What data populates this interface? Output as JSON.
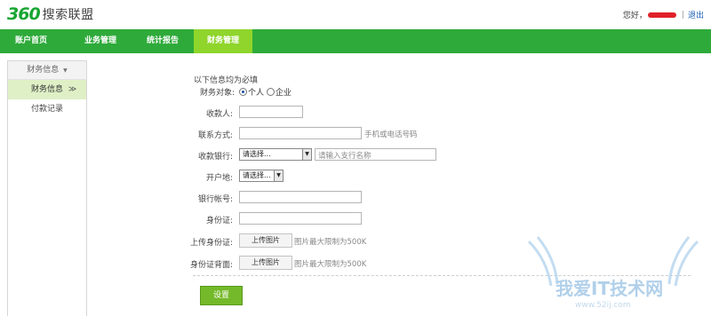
{
  "brand": {
    "logo_num": "360",
    "logo_text": "搜索联盟"
  },
  "user": {
    "greeting": "您好，",
    "separator": "|",
    "logout": "退出"
  },
  "nav": {
    "items": [
      {
        "label": "账户首页"
      },
      {
        "label": "业务管理"
      },
      {
        "label": "统计报告"
      },
      {
        "label": "财务管理"
      }
    ],
    "active_index": 3
  },
  "sidebar": {
    "header": "财务信息",
    "header_icon": "caret-down",
    "items": [
      {
        "label": "财务信息",
        "suffix": "≫"
      },
      {
        "label": "付款记录"
      }
    ]
  },
  "form": {
    "required_note": "以下信息均为必填",
    "type_label": "财务对象:",
    "type_options": [
      {
        "label": "个人",
        "checked": true
      },
      {
        "label": "企业",
        "checked": false
      }
    ],
    "payee_label": "收款人:",
    "contact_label": "联系方式:",
    "contact_hint": "手机或电话号码",
    "bank_label": "收款银行:",
    "bank_select": "请选择...",
    "branch_placeholder": "请输入支行名称",
    "region_label": "开户地:",
    "region_select": "请选择...",
    "account_label": "银行帐号:",
    "id_label": "身份证:",
    "upload_id_label": "上传身份证:",
    "upload_id_back_label": "身份证背面:",
    "upload_button": "上传图片",
    "upload_hint": "图片最大限制为500K",
    "submit": "设置"
  },
  "watermark": {
    "text": "我爱IT技术网",
    "url": "www.52ij.com"
  },
  "colors": {
    "nav_bg": "#2eaa3a",
    "nav_active": "#8fd52b",
    "submit_bg": "#74b92a",
    "logo_green": "#18a631"
  }
}
